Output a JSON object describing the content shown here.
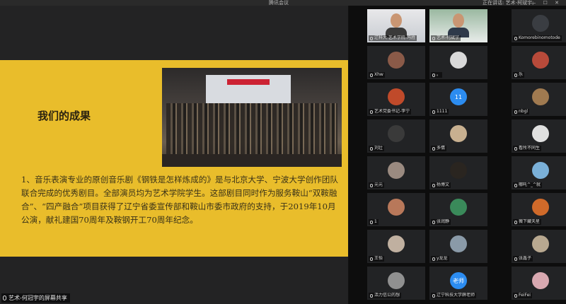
{
  "window": {
    "title": "腾讯会议",
    "speaking": "正在讲话: 艺术-柯斌宇;",
    "controls": "— ☐ ✕"
  },
  "slide": {
    "heading": "我们的成果",
    "photo_banner": "中国原创音乐剧",
    "body": "1、音乐表演专业的原创音乐剧《钢铁是怎样炼成的》是与北京大学、宁波大学创作团队联合完成的优秀剧目。全部演员均为艺术学院学生。这部剧目同时作为服务鞍山“双鞍融合”、“四产融合”项目获得了辽宁省委宣传部和鞍山市委市政府的支持，于2019年10月公演，献礼建国70周年及鞍钢开工70周年纪念。"
  },
  "share_label": "艺术-何冠宇的屏幕共享",
  "participants": [
    {
      "name": "辽科大 艺术学院-冯胜",
      "avatar": "",
      "color": "#6b8fb5",
      "video": true
    },
    {
      "name": "艺术-柯斌宇",
      "avatar": "",
      "color": "#5c8f6e",
      "video": true
    },
    {
      "name": "Komorebinomotode",
      "avatar": "",
      "color": "#3a3d42",
      "video": false
    },
    {
      "name": "Xhw",
      "avatar": "",
      "color": "#8a5a48",
      "video": false
    },
    {
      "name": "。",
      "avatar": "",
      "color": "#d9d9d9",
      "video": false
    },
    {
      "name": "乐",
      "avatar": "",
      "color": "#b84a3a",
      "video": false
    },
    {
      "name": "艺术党委书记-李宁",
      "avatar": "",
      "color": "#c04a2a",
      "video": false
    },
    {
      "name": "1111",
      "avatar": "11",
      "color": "#2c8cf0",
      "video": false
    },
    {
      "name": "nbgl",
      "avatar": "",
      "color": "#a07a50",
      "video": false
    },
    {
      "name": "刘壮",
      "avatar": "",
      "color": "#3a3a3a",
      "video": false
    },
    {
      "name": "多情",
      "avatar": "",
      "color": "#c8b090",
      "video": false
    },
    {
      "name": "看所不同生",
      "avatar": "",
      "color": "#e0e0e0",
      "video": false
    },
    {
      "name": "元元",
      "avatar": "",
      "color": "#9a8a80",
      "video": false
    },
    {
      "name": "杨博文",
      "avatar": "",
      "color": "#2a2520",
      "video": false
    },
    {
      "name": "哪吒^_^就",
      "avatar": "",
      "color": "#7ab0d8",
      "video": false
    },
    {
      "name": "1",
      "avatar": "",
      "color": "#b8785a",
      "video": false
    },
    {
      "name": "张润静",
      "avatar": "",
      "color": "#3a8a5a",
      "video": false
    },
    {
      "name": "薇下藏天星",
      "avatar": "",
      "color": "#d06a2a",
      "video": false
    },
    {
      "name": "王怡",
      "avatar": "",
      "color": "#c0b0a0",
      "video": false
    },
    {
      "name": "y龙龙",
      "avatar": "",
      "color": "#8a9aa8",
      "video": false
    },
    {
      "name": "张鑫子",
      "avatar": "",
      "color": "#b8a890",
      "video": false
    },
    {
      "name": "活力信公的想",
      "avatar": "",
      "color": "#909090",
      "video": false
    },
    {
      "name": "辽宁科技大学薛老师",
      "avatar": "老师",
      "color": "#2c8cf0",
      "video": false
    },
    {
      "name": "FeiFei",
      "avatar": "",
      "color": "#d8a8b0",
      "video": false
    }
  ]
}
